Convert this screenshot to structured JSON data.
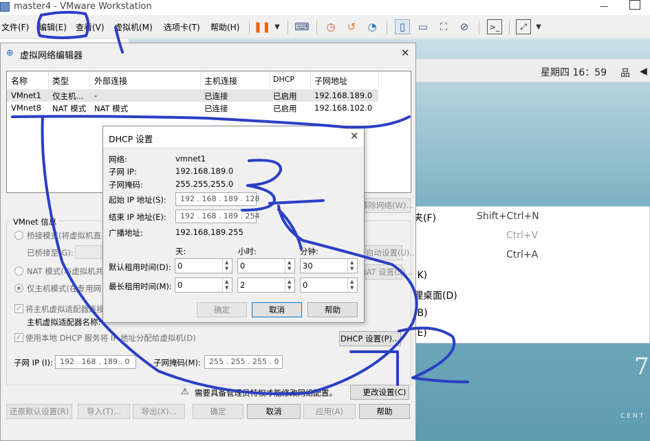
{
  "window": {
    "title": "master4 - VMware Workstation"
  },
  "menubar": {
    "items": [
      "文件(F)",
      "编辑(E)",
      "查看(V)",
      "虚拟机(M)",
      "选项卡(T)",
      "帮助(H)"
    ]
  },
  "guest": {
    "clock": "星期四 16：59",
    "brand": "CENT",
    "context_menu": [
      {
        "label": "夹(F)",
        "shortcut": "Shift+Ctrl+N",
        "enabled": true
      },
      {
        "label": "",
        "shortcut": "Ctrl+V",
        "enabled": false
      },
      {
        "label": "",
        "shortcut": "Ctrl+A",
        "enabled": true
      },
      {
        "label": "(K)",
        "shortcut": "",
        "enabled": true
      },
      {
        "label": "理桌面(D)",
        "shortcut": "",
        "enabled": true
      },
      {
        "label": "(B)",
        "shortcut": "",
        "enabled": true
      },
      {
        "label": "(E)",
        "shortcut": "",
        "enabled": true
      }
    ]
  },
  "vne": {
    "title": "虚拟网络编辑器",
    "columns": [
      "名称",
      "类型",
      "外部连接",
      "主机连接",
      "DHCP",
      "子网地址"
    ],
    "rows": [
      {
        "name": "VMnet1",
        "type": "仅主机...",
        "external": "-",
        "host": "已连接",
        "dhcp": "已启用",
        "subnet": "192.168.189.0"
      },
      {
        "name": "VMnet8",
        "type": "NAT 模式",
        "external": "NAT 模式",
        "host": "已连接",
        "dhcp": "已启用",
        "subnet": "192.168.102.0"
      }
    ],
    "remove_network_btn": "移除网络(W)...",
    "group_label": "VMnet 信息",
    "bridge_radio": "桥接模式(将虚拟机直",
    "bridged_to": "已桥接至(G):",
    "auto_settings_btn": "自动设置(U)...",
    "nat_radio": "NAT 模式(与虚拟机共",
    "nat_settings_btn": "NAT 设置(S)...",
    "hostonly_radio": "仅主机模式(在专用网",
    "connect_adapter_chk": "将主机虚拟适配器连接",
    "adapter_name_text": "主机虚拟适配器名称:",
    "use_dhcp_chk": "使用本地 DHCP 服务将 IP 地址分配给虚拟机(D)",
    "dhcp_settings_btn": "DHCP 设置(P)...",
    "subnet_ip_label": "子网 IP (I):",
    "subnet_ip": "192 . 168 . 189 .  0",
    "subnet_mask_label": "子网掩码(M):",
    "subnet_mask": "255 . 255 . 255 .  0",
    "warning_text": "需要具备管理员特权才能修改网络配置。",
    "change_settings_btn": "更改设置(C)",
    "buttons": {
      "restore": "还原默认设置(R)",
      "import": "导入(T)...",
      "export": "导出(X)...",
      "ok": "确定",
      "cancel": "取消",
      "apply": "应用(A)",
      "help": "帮助"
    }
  },
  "dhcp": {
    "title": "DHCP 设置",
    "network_label": "网络:",
    "network_value": "vmnet1",
    "subnet_ip_label": "子网 IP:",
    "subnet_ip_value": "192.168.189.0",
    "subnet_mask_label": "子网掩码:",
    "subnet_mask_value": "255.255.255.0",
    "start_ip_label": "起始 IP 地址(S):",
    "start_ip_value": "192 . 168 . 189 . 128",
    "end_ip_label": "结束 IP 地址(E):",
    "end_ip_value": "192 . 168 . 189 . 254",
    "broadcast_label": "广播地址:",
    "broadcast_value": "192.168.189.255",
    "col_days": "天:",
    "col_hours": "小时:",
    "col_minutes": "分钟:",
    "default_lease_label": "默认租用时间(D):",
    "default_lease": {
      "days": "0",
      "hours": "0",
      "minutes": "30"
    },
    "max_lease_label": "最长租用时间(M):",
    "max_lease": {
      "days": "0",
      "hours": "2",
      "minutes": "0"
    },
    "ok": "确定",
    "cancel": "取消",
    "help": "帮助"
  },
  "annotations": {
    "color": "#2b3fc4",
    "labels": [
      "1",
      "2",
      "3"
    ]
  }
}
